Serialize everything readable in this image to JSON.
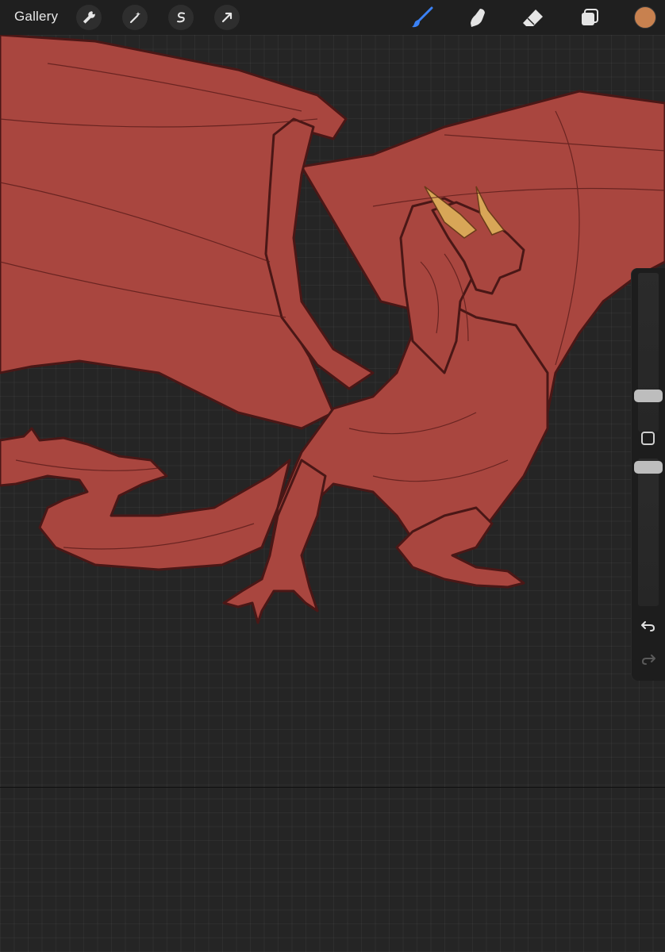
{
  "topbar": {
    "gallery_label": "Gallery",
    "left_tools": [
      {
        "name": "actions",
        "icon": "wrench-icon"
      },
      {
        "name": "adjustments",
        "icon": "magic-wand-icon"
      },
      {
        "name": "selection",
        "icon": "selection-s-icon"
      },
      {
        "name": "transform",
        "icon": "arrow-cursor-icon"
      }
    ],
    "right_tools": [
      {
        "name": "brush",
        "icon": "brush-icon",
        "active": true
      },
      {
        "name": "smudge",
        "icon": "smudge-finger-icon",
        "active": false
      },
      {
        "name": "eraser",
        "icon": "eraser-icon",
        "active": false
      },
      {
        "name": "layers",
        "icon": "layers-icon",
        "active": false
      }
    ],
    "current_color": "#c8814f",
    "active_tool_color": "#3b82f6"
  },
  "sidebar": {
    "brush_size_fraction": 0.2,
    "opacity_fraction": 0.98,
    "undo_icon": "undo-icon",
    "redo_icon": "redo-icon"
  },
  "canvas": {
    "background": "#252525",
    "artwork_fill": "#a9463f",
    "artwork_line": "#4a1716",
    "horn_color": "#d8a657"
  }
}
